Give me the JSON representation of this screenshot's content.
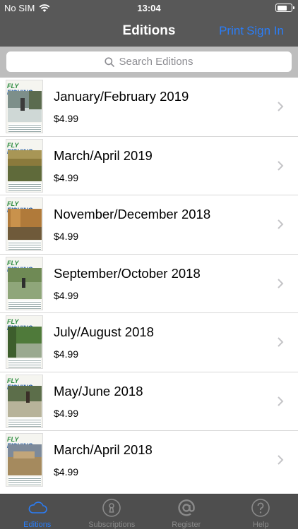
{
  "status": {
    "carrier": "No SIM",
    "time": "13:04"
  },
  "nav": {
    "title": "Editions",
    "right_print": "Print",
    "right_signin": "Sign In"
  },
  "search": {
    "placeholder": "Search Editions"
  },
  "editions": [
    {
      "title": "January/February 2019",
      "price": "$4.99"
    },
    {
      "title": "March/April 2019",
      "price": "$4.99"
    },
    {
      "title": "November/December 2018",
      "price": "$4.99"
    },
    {
      "title": "September/October 2018",
      "price": "$4.99"
    },
    {
      "title": "July/August 2018",
      "price": "$4.99"
    },
    {
      "title": "May/June 2018",
      "price": "$4.99"
    },
    {
      "title": "March/April 2018",
      "price": "$4.99"
    }
  ],
  "cover_masthead": {
    "top": "FLY",
    "bottom": "FISHING"
  },
  "tabs": [
    {
      "label": "Editions",
      "icon": "cloud-icon",
      "active": true
    },
    {
      "label": "Subscriptions",
      "icon": "keyhole-icon",
      "active": false
    },
    {
      "label": "Register",
      "icon": "at-icon",
      "active": false
    },
    {
      "label": "Help",
      "icon": "question-icon",
      "active": false
    }
  ],
  "colors": {
    "accent": "#2a7df7",
    "bar": "#585858",
    "tabbar": "#4e4e4e"
  }
}
